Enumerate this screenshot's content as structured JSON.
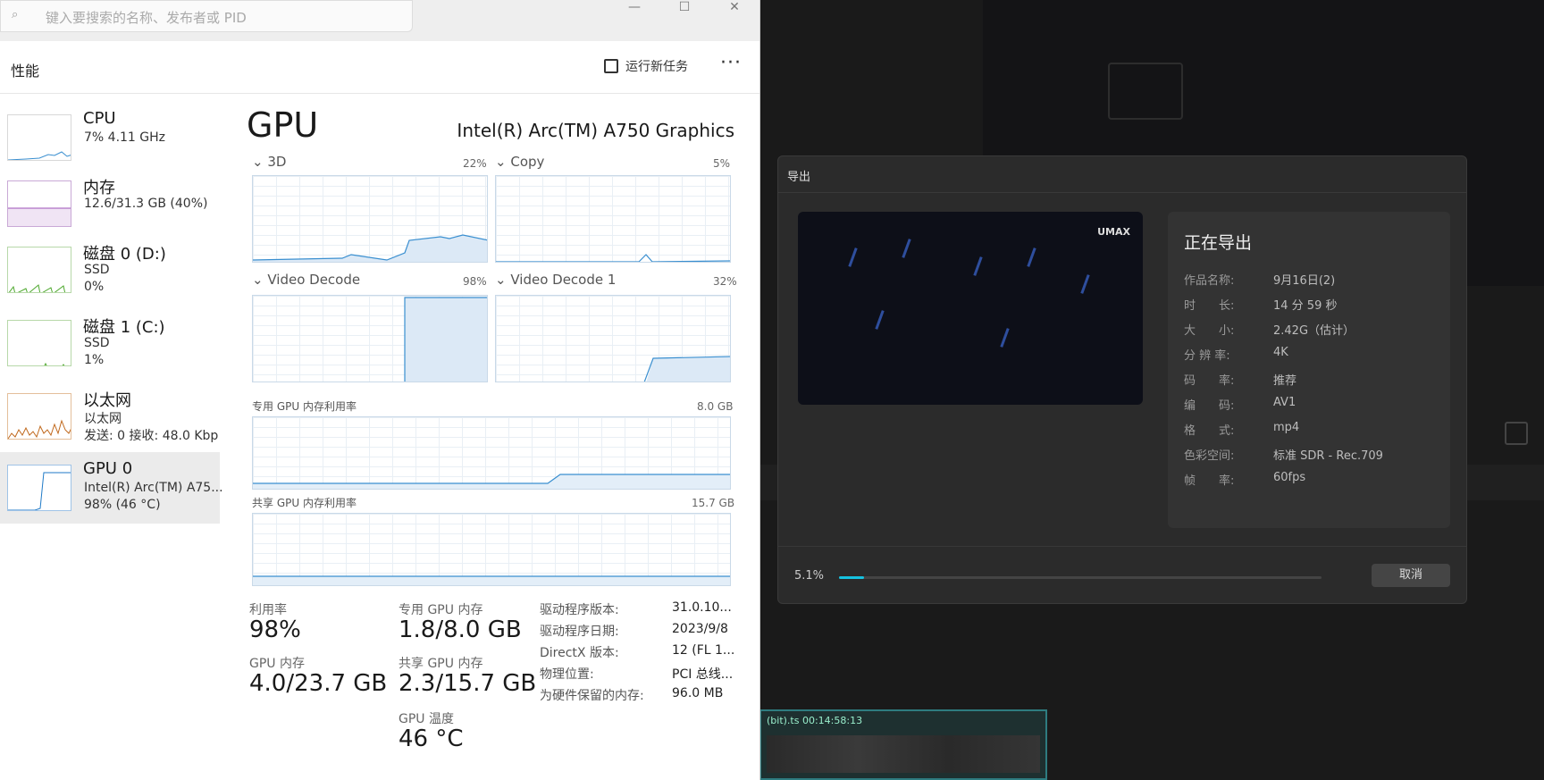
{
  "task_manager": {
    "search_placeholder": "键入要搜索的名称、发布者或 PID",
    "window_controls": {
      "minimize": "—",
      "maximize": "☐",
      "close": "✕"
    },
    "page_title": "性能",
    "run_new_task": "运行新任务",
    "more": "···",
    "sidebar": [
      {
        "title": "CPU",
        "line1": "7% 4.11 GHz",
        "line2": ""
      },
      {
        "title": "内存",
        "line1": "12.6/31.3 GB (40%)",
        "line2": ""
      },
      {
        "title": "磁盘 0 (D:)",
        "line1": "SSD",
        "line2": "0%"
      },
      {
        "title": "磁盘 1 (C:)",
        "line1": "SSD",
        "line2": "1%"
      },
      {
        "title": "以太网",
        "line1": "以太网",
        "line2": "发送: 0 接收: 48.0 Kbp"
      },
      {
        "title": "GPU 0",
        "line1": "Intel(R) Arc(TM) A75...",
        "line2": "98% (46 °C)"
      }
    ],
    "gpu": {
      "title": "GPU",
      "name": "Intel(R) Arc(TM) A750 Graphics",
      "engines": [
        {
          "label": "3D",
          "pct": "22%"
        },
        {
          "label": "Copy",
          "pct": "5%"
        },
        {
          "label": "Video Decode",
          "pct": "98%"
        },
        {
          "label": "Video Decode 1",
          "pct": "32%"
        }
      ],
      "dedicated_label": "专用 GPU 内存利用率",
      "dedicated_max": "8.0 GB",
      "shared_label": "共享 GPU 内存利用率",
      "shared_max": "15.7 GB",
      "stats": {
        "util_label": "利用率",
        "util_value": "98%",
        "gpu_mem_label": "GPU 内存",
        "gpu_mem_value": "4.0/23.7 GB",
        "ded_mem_label": "专用 GPU 内存",
        "ded_mem_value": "1.8/8.0 GB",
        "shared_mem_label": "共享 GPU 内存",
        "shared_mem_value": "2.3/15.7 GB",
        "temp_label": "GPU 温度",
        "temp_value": "46 °C"
      },
      "details": [
        {
          "k": "驱动程序版本:",
          "v": "31.0.10..."
        },
        {
          "k": "驱动程序日期:",
          "v": "2023/9/8"
        },
        {
          "k": "DirectX 版本:",
          "v": "12 (FL 1..."
        },
        {
          "k": "物理位置:",
          "v": "PCI 总线..."
        },
        {
          "k": "为硬件保留的内存:",
          "v": "96.0 MB"
        }
      ]
    }
  },
  "export_dialog": {
    "title": "导出",
    "video_watermark": "UMAX",
    "status_title": "正在导出",
    "info": [
      {
        "k": "作品名称:",
        "v": "9月16日(2)"
      },
      {
        "k": "时　　长:",
        "v": "14 分 59 秒"
      },
      {
        "k": "大　　小:",
        "v": "2.42G（估计）"
      },
      {
        "k": "分 辨 率:",
        "v": "4K"
      },
      {
        "k": "码　　率:",
        "v": "推荐"
      },
      {
        "k": "编　　码:",
        "v": "AV1"
      },
      {
        "k": "格　　式:",
        "v": "mp4"
      },
      {
        "k": "色彩空间:",
        "v": "标准 SDR - Rec.709"
      },
      {
        "k": "帧　　率:",
        "v": "60fps"
      }
    ],
    "progress_text": "5.1%",
    "progress_fraction": 0.051,
    "cancel_label": "取消",
    "accent_color": "#16c2e0"
  },
  "timeline": {
    "clip_label": "(bit).ts  00:14:58:13"
  }
}
